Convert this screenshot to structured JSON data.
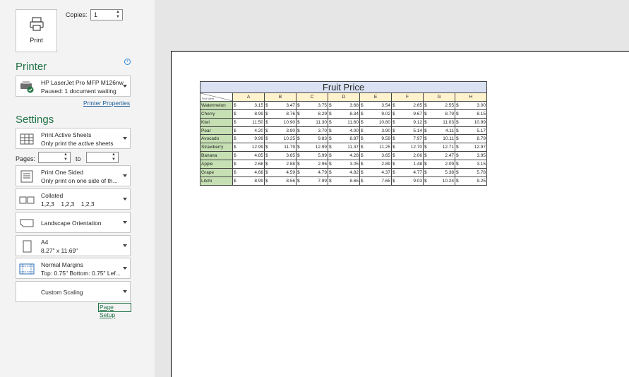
{
  "print_button": {
    "label": "Print",
    "icon": "printer-icon"
  },
  "copies": {
    "label": "Copies:",
    "value": "1"
  },
  "printer": {
    "heading": "Printer",
    "name": "HP LaserJet Pro MFP M126nw",
    "status": "Paused: 1 document waiting",
    "properties_link": "Printer Properties"
  },
  "settings": {
    "heading": "Settings",
    "what": {
      "line1": "Print Active Sheets",
      "line2": "Only print the active sheets"
    },
    "pages": {
      "label": "Pages:",
      "to_label": "to",
      "from": "",
      "to": ""
    },
    "sides": {
      "line1": "Print One Sided",
      "line2": "Only print on one side of th..."
    },
    "collation": {
      "line1": "Collated",
      "line2": "1,2,3    1,2,3    1,2,3"
    },
    "orientation": {
      "line1": "Landscape Orientation"
    },
    "paper": {
      "line1": "A4",
      "line2": "8.27\" x 11.69\""
    },
    "margins": {
      "line1": "Normal Margins",
      "line2": "Top: 0.75\" Bottom: 0.75\" Lef..."
    },
    "scaling": {
      "line1": "Custom Scaling"
    },
    "page_setup_link": "Page Setup"
  },
  "sheet": {
    "title": "Fruit Price",
    "corner_label": "Fruit Name",
    "columns": [
      "A",
      "B",
      "C",
      "D",
      "E",
      "F",
      "G",
      "H"
    ],
    "currency": "$",
    "rows": [
      {
        "name": "Watermelon",
        "values": [
          "3.15",
          "3.47",
          "3.75",
          "3.68",
          "3.54",
          "2.65",
          "2.55",
          "3.00"
        ]
      },
      {
        "name": "Cherry",
        "values": [
          "8.99",
          "8.76",
          "8.29",
          "8.34",
          "9.02",
          "9.67",
          "8.79",
          "8.15"
        ]
      },
      {
        "name": "Kiwi",
        "values": [
          "11.50",
          "10.90",
          "11.30",
          "11.60",
          "10.80",
          "9.12",
          "11.03",
          "10.99"
        ]
      },
      {
        "name": "Pear",
        "values": [
          "4.20",
          "3.90",
          "3.70",
          "4.00",
          "3.90",
          "5.14",
          "4.11",
          "5.17"
        ]
      },
      {
        "name": "Avocado",
        "values": [
          "9.99",
          "10.25",
          "9.83",
          "8.87",
          "9.59",
          "7.97",
          "10.11",
          "8.79"
        ]
      },
      {
        "name": "Strawberry",
        "values": [
          "12.99",
          "11.79",
          "12.99",
          "11.37",
          "11.25",
          "12.70",
          "12.71",
          "12.97"
        ]
      },
      {
        "name": "Banana",
        "values": [
          "4.85",
          "3.65",
          "5.99",
          "4.28",
          "3.65",
          "2.06",
          "2.47",
          "3.95"
        ]
      },
      {
        "name": "Apple",
        "values": [
          "2.68",
          "2.88",
          "2.96",
          "3.05",
          "2.89",
          "1.48",
          "2.09",
          "3.15"
        ]
      },
      {
        "name": "Grape",
        "values": [
          "4.68",
          "4.59",
          "4.79",
          "4.82",
          "4.37",
          "4.77",
          "5.38",
          "5.78"
        ]
      },
      {
        "name": "Litchi",
        "values": [
          "8.99",
          "8.56",
          "7.99",
          "8.65",
          "7.65",
          "9.03",
          "10.24",
          "9.25"
        ]
      }
    ]
  },
  "colors": {
    "accent_green": "#217346",
    "title_fill": "#d9e1f2",
    "header_fill": "#fff2cc",
    "fruit_fill": "#c6e0b4"
  }
}
